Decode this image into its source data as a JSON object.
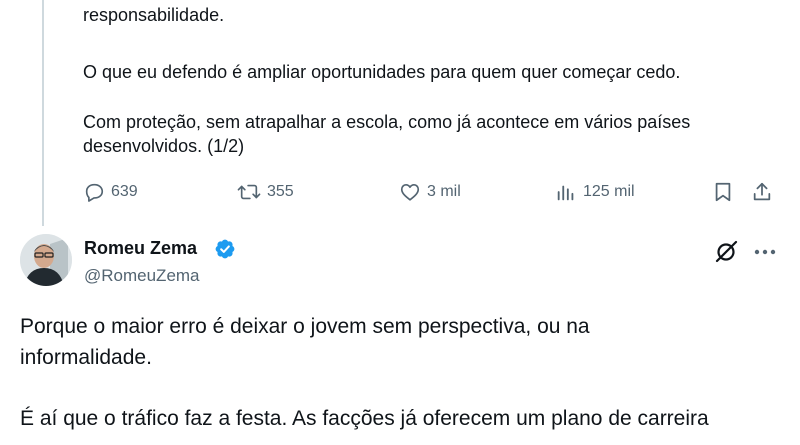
{
  "previous_tweet": {
    "paragraphs": [
      "responsabilidade.",
      "O que eu defendo é ampliar oportunidades para quem quer começar cedo.",
      "Com proteção, sem atrapalhar a escola, como já acontece em vários países desenvolvidos. (1/2)"
    ],
    "actions": {
      "replies": "639",
      "retweets": "355",
      "likes": "3 mil",
      "views": "125 mil"
    }
  },
  "tweet": {
    "author_name": "Romeu Zema",
    "author_handle": "@RomeuZema",
    "verified_color": "#1d9bf0",
    "paragraphs": [
      "Porque o maior erro é deixar o jovem sem perspectiva, ou na informalidade.",
      "É aí que o tráfico faz a festa. As facções já oferecem um plano de carreira"
    ]
  },
  "colors": {
    "text": "#0f1419",
    "secondary": "#536471",
    "thread_line": "#cfd9de",
    "accent": "#1d9bf0"
  },
  "icons": {
    "reply": "reply-icon",
    "retweet": "retweet-icon",
    "like": "heart-icon",
    "views": "views-icon",
    "bookmark": "bookmark-icon",
    "share": "share-icon",
    "grok": "grok-icon",
    "more": "more-icon",
    "verified": "verified-badge-icon"
  }
}
